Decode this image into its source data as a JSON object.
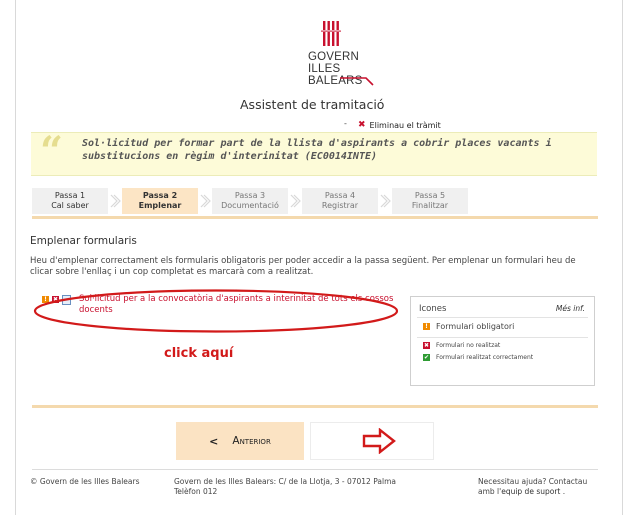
{
  "header": {
    "logo_lines": [
      "GOVERN",
      "ILLES",
      "BALEARS"
    ],
    "assistant_title": "Assistent de tramitació",
    "delete_separator": "-",
    "delete_label": "Eliminau el tràmit"
  },
  "procedure": {
    "title": "Sol·licitud per formar part de la llista d'aspirants a cobrir places vacants i substitucions en règim d'interinitat (EC0014INTE)"
  },
  "steps": [
    {
      "line1": "Passa 1",
      "line2": "Cal saber"
    },
    {
      "line1": "Passa 2",
      "line2": "Emplenar"
    },
    {
      "line1": "Passa 3",
      "line2": "Documentació"
    },
    {
      "line1": "Passa 4",
      "line2": "Registrar"
    },
    {
      "line1": "Passa 5",
      "line2": "Finalitzar"
    }
  ],
  "active_step": 2,
  "section": {
    "title": "Emplenar formularis",
    "description": "Heu d'emplenar correctament els formularis obligatoris per poder accedir a la passa següent. Per emplenar un formulari heu de clicar sobre l'enllaç i un cop completat es marcarà com a realitzat.",
    "form_link": "Sol·licitud per a la convocatòria d'aspirants a interinitat de tots els cossos docents",
    "icon_required": "!",
    "icon_incomplete": "✖"
  },
  "annotation": {
    "click_here": "click aquí",
    "ellipse_color": "#d21a1a"
  },
  "icons_legend": {
    "title": "Icones",
    "more": "Més inf.",
    "required": "Formulari obligatori",
    "not_done": "Formulari no realitzat",
    "done": "Formulari realitzat correctament",
    "check": "✔"
  },
  "nav": {
    "prev_arrow": "<",
    "prev_label": "Anterior"
  },
  "footer": {
    "copyright": "© Govern de les Illes Balears",
    "address_line1": "Govern de les Illes Balears: C/ de la Llotja, 3 - 07012 Palma",
    "address_line2": "Telèfon 012",
    "help_line1": "Necessitau ajuda? Contactau",
    "help_prefix": "amb l'",
    "help_link": "equip de suport",
    "help_suffix": " ."
  },
  "colors": {
    "accent_red": "#c8102e",
    "step_active_bg": "#fce5c5",
    "banner_bg": "#fdfbd8"
  }
}
